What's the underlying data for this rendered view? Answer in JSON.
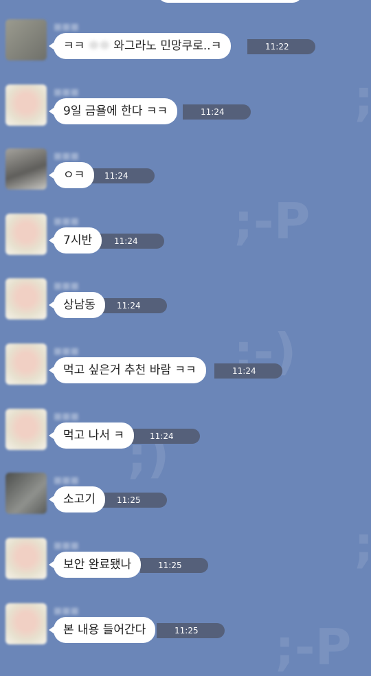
{
  "background": {
    "color": "#6b86b8",
    "bubble_color": "#ffffff",
    "time_pill_color": "#55607a"
  },
  "watermark": {
    "glyphs": [
      ";-P",
      ";-)",
      ";)",
      ";",
      ";",
      ";-P"
    ]
  },
  "messages": [
    {
      "avatar": "gray-avatar",
      "text_before": "ㅋㅋ",
      "text_hidden": "ㅇㅇ",
      "text_after": "와그라노 민망쿠로..ㅋ",
      "time": "11:22"
    },
    {
      "avatar": "pink-avatar",
      "text": "9일 금욜에 한다 ㅋㅋ",
      "time": "11:24"
    },
    {
      "avatar": "cat-avatar",
      "text": "ㅇㅋ",
      "time": "11:24"
    },
    {
      "avatar": "pink-avatar",
      "text": "7시반",
      "time": "11:24"
    },
    {
      "avatar": "pink-avatar",
      "text": "상남동",
      "time": "11:24"
    },
    {
      "avatar": "pink-avatar",
      "text": "먹고 싶은거 추천 바람 ㅋㅋ",
      "time": "11:24"
    },
    {
      "avatar": "pink-avatar",
      "text": "먹고 나서 ㅋ",
      "time": "11:24"
    },
    {
      "avatar": "dark-avatar",
      "text": "소고기",
      "time": "11:25"
    },
    {
      "avatar": "pink-avatar",
      "text": "보안 완료됐나",
      "time": "11:25"
    },
    {
      "avatar": "pink-avatar",
      "text": "본 내용 들어간다",
      "time": "11:25"
    }
  ]
}
